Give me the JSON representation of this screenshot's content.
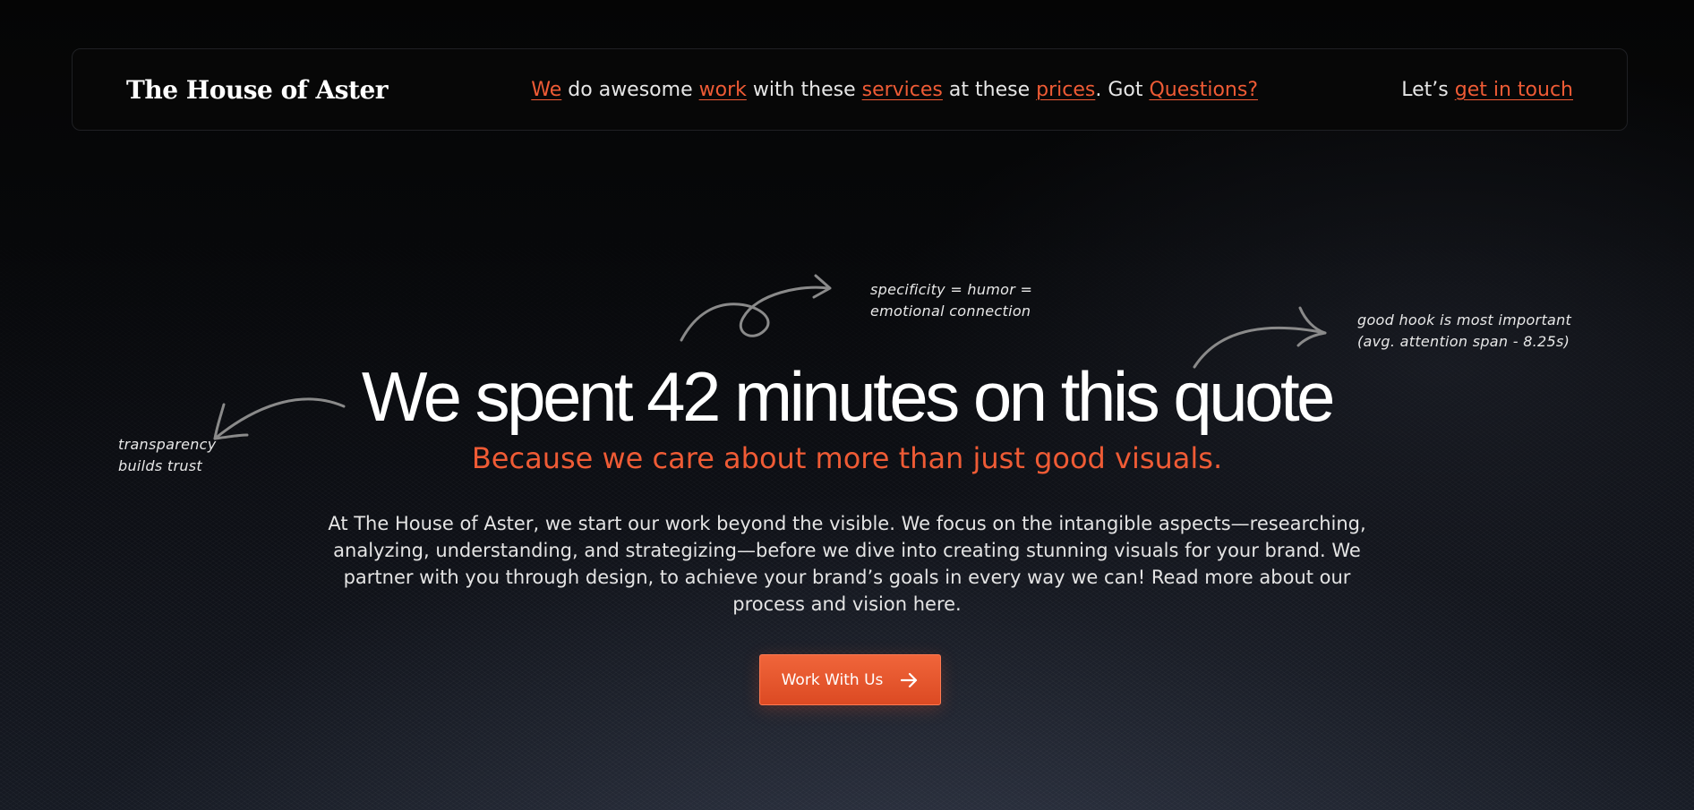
{
  "nav": {
    "brand": "The House of Aster",
    "sentence": {
      "we": "We",
      "t1": " do awesome ",
      "work": "work",
      "t2": " with these ",
      "services": "services",
      "t3": " at these ",
      "prices": "prices",
      "t4": ". Got ",
      "questions": "Questions?"
    },
    "contact_prefix": "Let’s ",
    "contact_link": "get in touch"
  },
  "hero": {
    "title": "We spent 42 minutes on this quote",
    "subtitle": "Because we care about more than just good visuals.",
    "body": "At The House of Aster, we start our work beyond the visible. We focus on the intangible aspects—researching, analyzing, understanding, and strategizing—before we dive into creating stunning visuals for your brand. We partner with you through design, to achieve your brand’s goals in every way we can! Read more about our process and vision here.",
    "cta_label": "Work With Us",
    "cta_icon": "arrow-right-icon"
  },
  "annotations": {
    "specificity": [
      "specificity = humor =",
      "emotional connection"
    ],
    "hook": [
      "good hook is most important",
      "(avg. attention span - 8.25s)"
    ],
    "transparency": [
      "transparency",
      "builds trust"
    ]
  },
  "colors": {
    "accent": "#ef5b35",
    "background": "#050505",
    "text": "#ffffff"
  }
}
